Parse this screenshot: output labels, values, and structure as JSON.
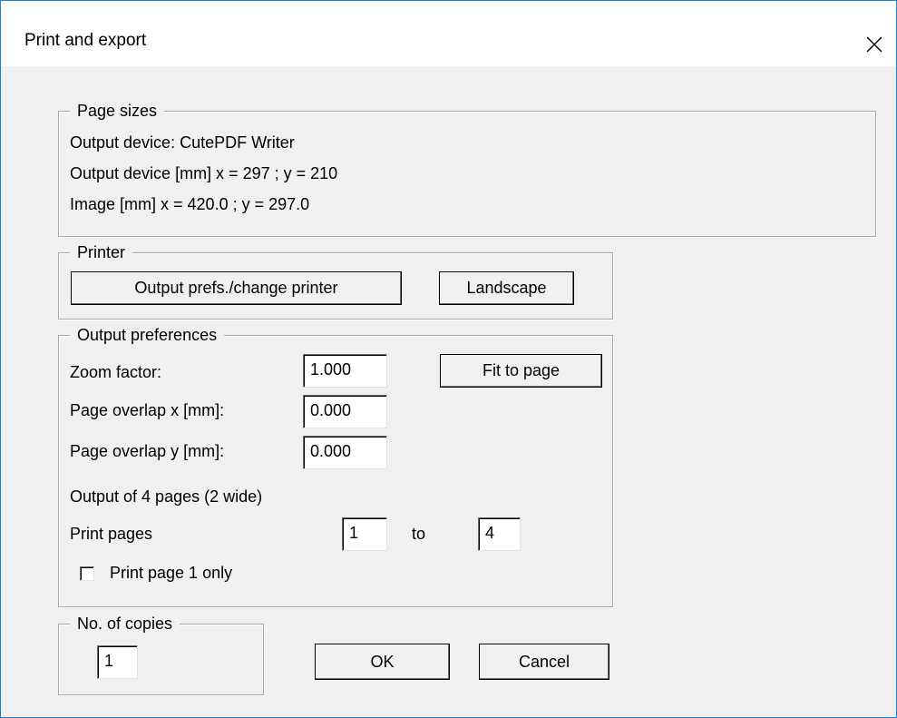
{
  "window": {
    "title": "Print and export",
    "close_icon": "close-icon"
  },
  "page_sizes": {
    "legend": "Page sizes",
    "output_device": "Output device: CutePDF Writer",
    "output_device_mm": "Output device [mm]  x = 297 ; y = 210",
    "image_mm": "Image [mm]  x = 420.0 ; y = 297.0"
  },
  "printer": {
    "legend": "Printer",
    "change_printer_label": "Output prefs./change printer",
    "orientation_label": "Landscape"
  },
  "output_prefs": {
    "legend": "Output preferences",
    "zoom_label": "Zoom factor:",
    "zoom_value": "1.000",
    "fit_label": "Fit to page",
    "overlap_x_label": "Page overlap x [mm]:",
    "overlap_x_value": "0.000",
    "overlap_y_label": "Page overlap y [mm]:",
    "overlap_y_value": "0.000",
    "output_info": "Output of 4 pages (2 wide)",
    "print_pages_label": "Print pages",
    "from_value": "1",
    "to_label": "to",
    "to_value": "4",
    "page1_only_label": "Print page 1 only",
    "page1_only_checked": false
  },
  "copies": {
    "legend": "No. of copies",
    "value": "1"
  },
  "buttons": {
    "ok_label": "OK",
    "cancel_label": "Cancel"
  }
}
